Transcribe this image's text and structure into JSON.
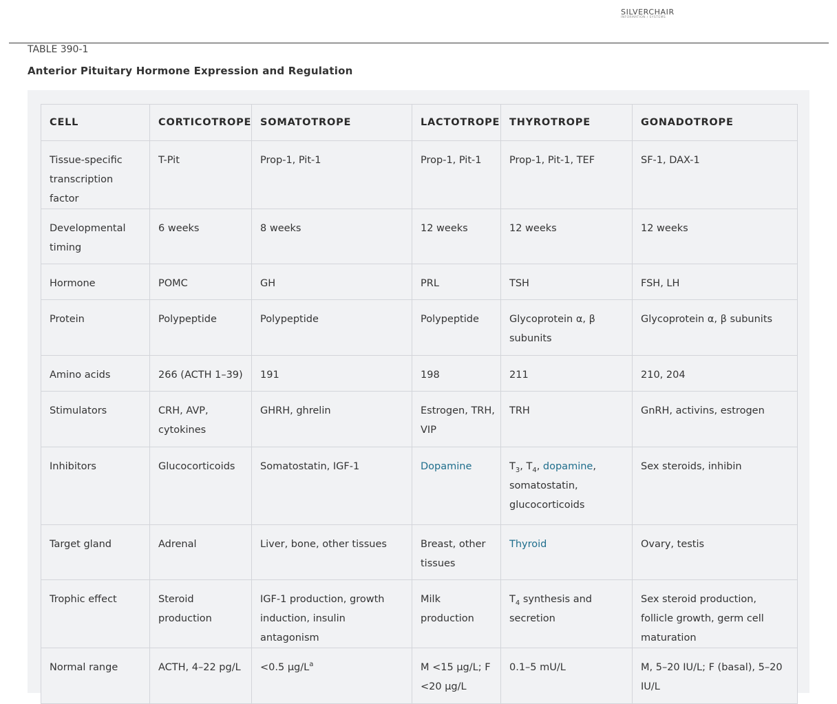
{
  "logo": {
    "main": "SILVERCHAIR",
    "sub": "INFORMATION / SYSTEMS"
  },
  "table_label": "TABLE 390-1",
  "table_title": "Anterior Pituitary Hormone Expression and Regulation",
  "headers": [
    "CELL",
    "CORTICOTROPE",
    "SOMATOTROPE",
    "LACTOTROPE",
    "THYROTROPE",
    "GONADOTROPE"
  ],
  "rows": {
    "r0": {
      "label": "Tissue-specific transcription factor",
      "c1": "T-Pit",
      "c2": "Prop-1, Pit-1",
      "c3": "Prop-1, Pit-1",
      "c4": "Prop-1, Pit-1, TEF",
      "c5": "SF-1, DAX-1"
    },
    "r1": {
      "label": "Developmental timing",
      "c1": "6 weeks",
      "c2": "8 weeks",
      "c3": "12 weeks",
      "c4": "12 weeks",
      "c5": "12 weeks"
    },
    "r2": {
      "label": "Hormone",
      "c1": "POMC",
      "c2": "GH",
      "c3": "PRL",
      "c4": "TSH",
      "c5": "FSH, LH"
    },
    "r3": {
      "label": "Protein",
      "c1": "Polypeptide",
      "c2": "Polypeptide",
      "c3": "Polypeptide",
      "c4": "Glycoprotein α, β subunits",
      "c5": "Glycoprotein α, β subunits"
    },
    "r4": {
      "label": "Amino acids",
      "c1": "266 (ACTH 1–39)",
      "c2": "191",
      "c3": "198",
      "c4": "211",
      "c5": "210, 204"
    },
    "r5": {
      "label": "Stimulators",
      "c1": "CRH, AVP, cytokines",
      "c2": "GHRH, ghrelin",
      "c3": "Estrogen, TRH, VIP",
      "c4": "TRH",
      "c5": "GnRH, activins, estrogen"
    },
    "r6": {
      "label": "Inhibitors",
      "c1": "Glucocorticoids",
      "c2": "Somatostatin, IGF-1",
      "c3": "Dopamine",
      "c4": {
        "t_a": "T",
        "s_a": "3",
        "sep1": ", T",
        "s_b": "4",
        "sep2": ", ",
        "link": "dopamine",
        "rest": ", somatostatin, glucocorticoids"
      },
      "c5": "Sex steroids, inhibin"
    },
    "r7": {
      "label": "Target gland",
      "c1": "Adrenal",
      "c2": "Liver, bone, other tissues",
      "c3": "Breast, other tissues",
      "c4": "Thyroid",
      "c5": "Ovary, testis"
    },
    "r8": {
      "label": "Trophic effect",
      "c1": "Steroid production",
      "c2": "IGF-1 production, growth induction, insulin antagonism",
      "c3": "Milk production",
      "c4": {
        "t": "T",
        "s": "4",
        "rest": " synthesis and secretion"
      },
      "c5": "Sex steroid production, follicle growth, germ cell maturation"
    },
    "r9": {
      "label": "Normal range",
      "c1": "ACTH, 4–22 pg/L",
      "c2": {
        "text": "<0.5 μg/L",
        "sup": "a"
      },
      "c3": "M <15 μg/L; F <20 μg/L",
      "c4": "0.1–5 mU/L",
      "c5": "M, 5–20 IU/L; F (basal), 5–20 IU/L"
    }
  },
  "colors": {
    "link": "#1f6e8c",
    "panel": "#f1f2f4",
    "grid": "#d3d5da"
  }
}
